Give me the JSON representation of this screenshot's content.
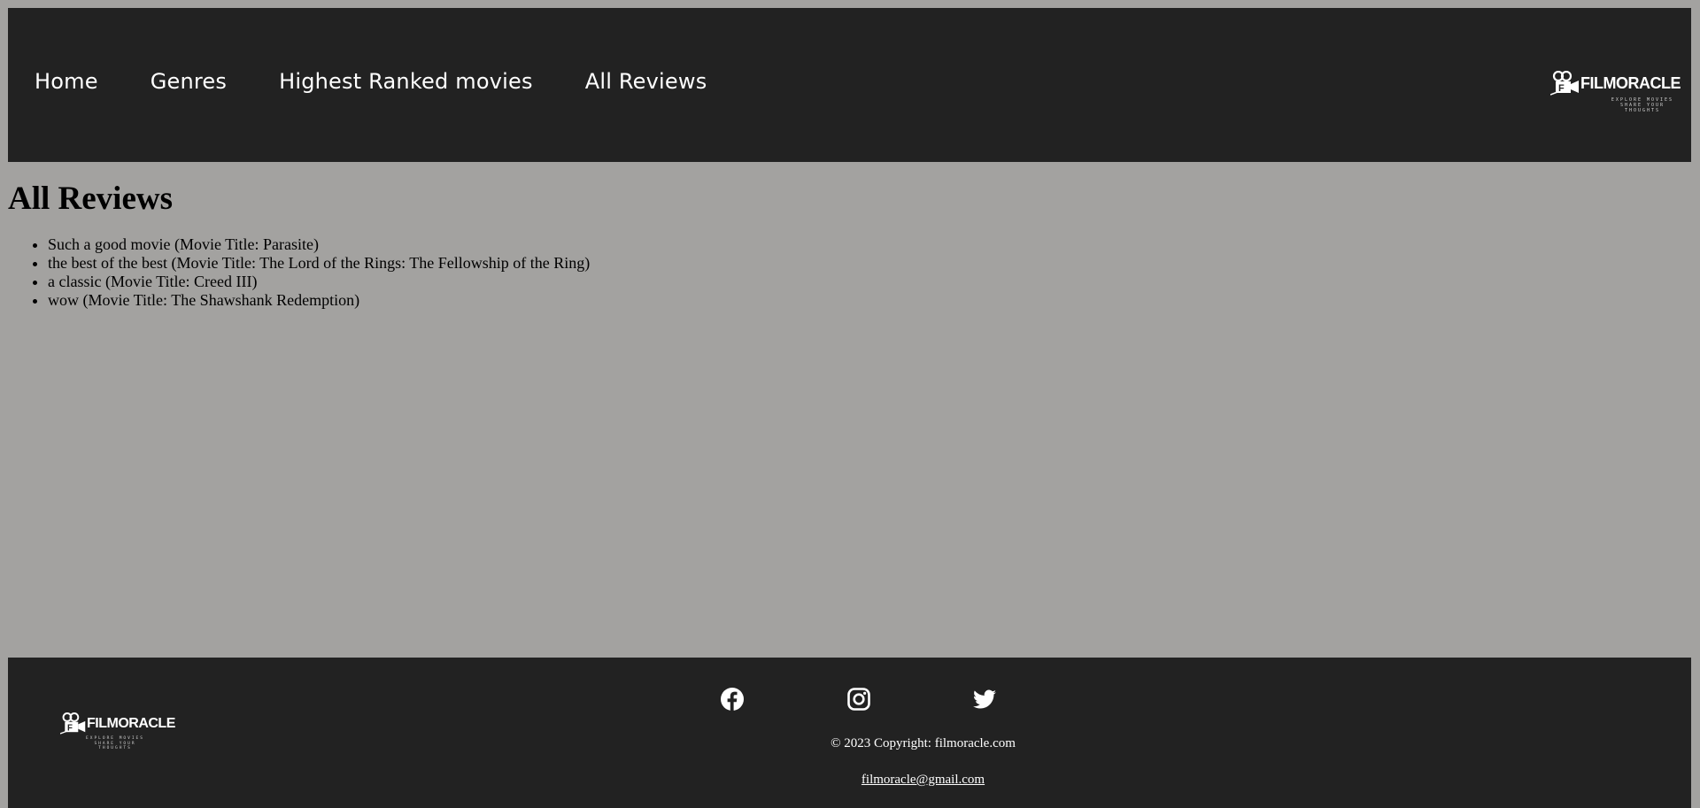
{
  "nav": {
    "items": [
      {
        "label": "Home"
      },
      {
        "label": "Genres"
      },
      {
        "label": "Highest Ranked movies"
      },
      {
        "label": "All Reviews"
      }
    ]
  },
  "logo": {
    "name": "FILMORACLE",
    "tagline": "EXPLORE MOVIES SHARE YOUR THOUGHTS"
  },
  "main": {
    "title": "All Reviews",
    "reviews": [
      "Such a good movie (Movie Title: Parasite)",
      "the best of the best (Movie Title: The Lord of the Rings: The Fellowship of the Ring)",
      "a classic (Movie Title: Creed III)",
      "wow (Movie Title: The Shawshank Redemption)"
    ]
  },
  "footer": {
    "socials": [
      "facebook-icon",
      "instagram-icon",
      "twitter-icon"
    ],
    "copyright": "© 2023 Copyright: filmoracle.com",
    "email": "filmoracle@gmail.com"
  },
  "colors": {
    "background": "#a3a2a0",
    "bar": "#222222",
    "text_light": "#ffffff"
  }
}
